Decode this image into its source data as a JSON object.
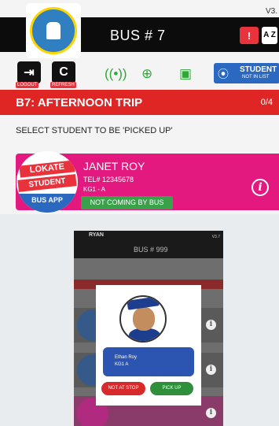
{
  "top_screen": {
    "version": "V3.",
    "title": "BUS # 7",
    "sort_icon": "A Z",
    "toolbar": {
      "logout_label": "LOGOUT",
      "refresh_label": "REFRESH",
      "student_btn_line1": "STUDENT",
      "student_btn_line2": "NOT IN LIST"
    },
    "trip": {
      "name": "B7: AFTERNOON TRIP",
      "count": "0/4"
    },
    "instruction": "SELECT STUDENT TO BE 'PICKED UP'",
    "badge": {
      "line1": "LOKATE",
      "line2": "STUDENT",
      "line3": "BUS APP"
    },
    "student": {
      "name": "JANET ROY",
      "tel": "TEL# 12345678",
      "class": "KG1 - A",
      "status": "NOT COMING BY BUS"
    }
  },
  "lower_screen": {
    "brand": "RYAN",
    "version": "V3.7",
    "title": "BUS # 999",
    "modal": {
      "student_name": "Ethan Roy",
      "student_class": "KG1 A",
      "not_at_stop_label": "NOT AT STOP",
      "pick_up_label": "PICK UP"
    }
  },
  "colors": {
    "header_bg": "#0c0c0c",
    "trip_bar": "#e02525",
    "card_bg": "#e4197f",
    "status_green": "#3aa04a",
    "accent_blue": "#2b68c0"
  }
}
